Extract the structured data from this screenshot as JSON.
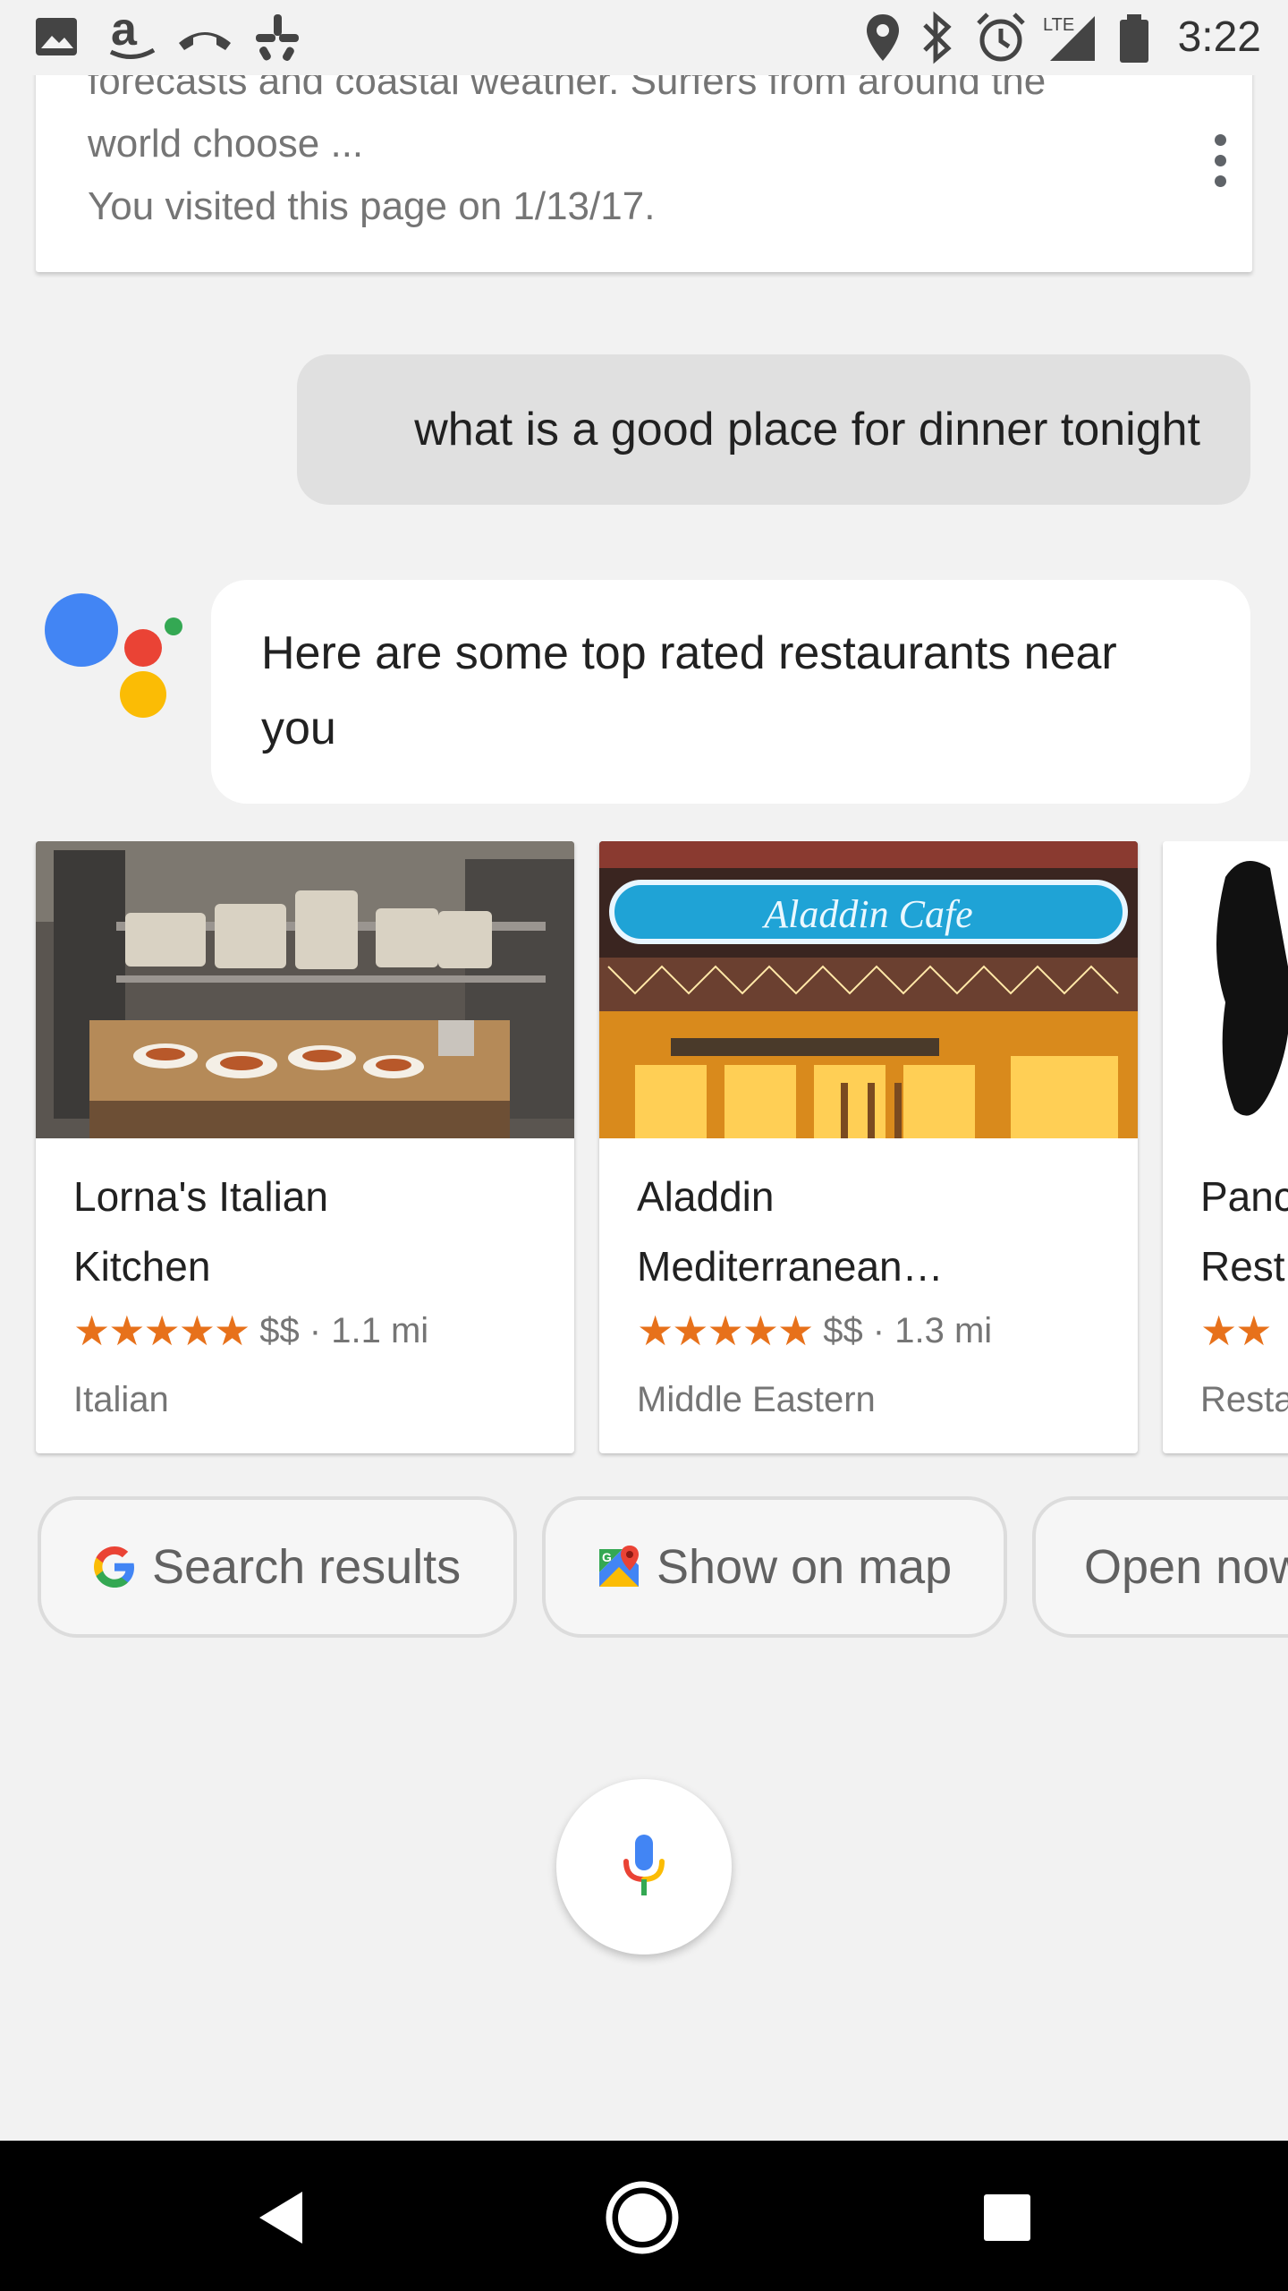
{
  "status_bar": {
    "time": "3:22",
    "network_label": "LTE",
    "icons": [
      "image-icon",
      "amazon-icon",
      "missed-call-icon",
      "yelp-icon",
      "location-icon",
      "bluetooth-icon",
      "alarm-icon",
      "signal-icon",
      "battery-icon"
    ]
  },
  "previous_card": {
    "line1": "forecasts and coastal weather. Surfers from around the",
    "line2": "world choose ...",
    "line3": "You visited this page on 1/13/17."
  },
  "user_query": "what is a good place for dinner tonight",
  "assistant_reply": "Here are some top rated restaurants near you",
  "restaurants": [
    {
      "name_line1": "Lorna's Italian",
      "name_line2": "Kitchen",
      "stars": "★★★★★",
      "rating": 4.5,
      "price_distance": "$$ · 1.1 mi",
      "category": "Italian"
    },
    {
      "name_line1": "Aladdin",
      "name_line2": "Mediterranean…",
      "stars": "★★★★★",
      "rating": 4.5,
      "price_distance": "$$ · 1.3 mi",
      "category": "Middle Eastern",
      "sign_text": "Aladdin Cafe"
    },
    {
      "name_line1": "Panc",
      "name_line2": "Rest",
      "stars": "★★",
      "price_distance": "",
      "category": "Resta"
    }
  ],
  "chips": {
    "search_results": "Search results",
    "show_on_map": "Show on map",
    "open_now": "Open now"
  },
  "colors": {
    "google_blue": "#4285f4",
    "google_red": "#ea4335",
    "google_yellow": "#fbbc05",
    "google_green": "#34a853",
    "star_orange": "#e7711b"
  }
}
